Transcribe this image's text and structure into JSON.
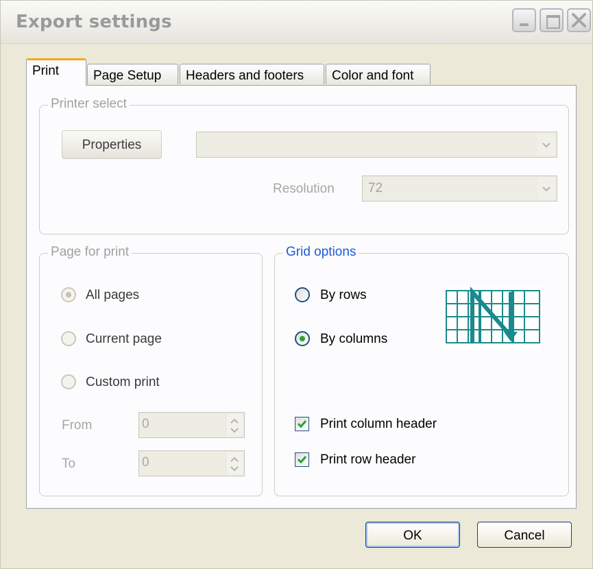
{
  "window": {
    "title": "Export settings"
  },
  "tabs": [
    {
      "label": "Print"
    },
    {
      "label": "Page Setup"
    },
    {
      "label": "Headers and footers"
    },
    {
      "label": "Color and font"
    }
  ],
  "printer_select": {
    "legend": "Printer select",
    "properties_label": "Properties",
    "printer_value": "",
    "resolution_label": "Resolution",
    "resolution_value": "72"
  },
  "page_for_print": {
    "legend": "Page for print",
    "options": [
      {
        "label": "All pages",
        "selected": true
      },
      {
        "label": "Current page",
        "selected": false
      },
      {
        "label": "Custom print",
        "selected": false
      }
    ],
    "from_label": "From",
    "from_value": "0",
    "to_label": "To",
    "to_value": "0"
  },
  "grid_options": {
    "legend": "Grid options",
    "by_rows_label": "By rows",
    "by_columns_label": "By columns",
    "selected": "By columns",
    "print_column_header_label": "Print column header",
    "print_column_header_checked": true,
    "print_row_header_label": "Print row header",
    "print_row_header_checked": true,
    "diagram_color": "#1a8a8c"
  },
  "buttons": {
    "ok": "OK",
    "cancel": "Cancel"
  }
}
